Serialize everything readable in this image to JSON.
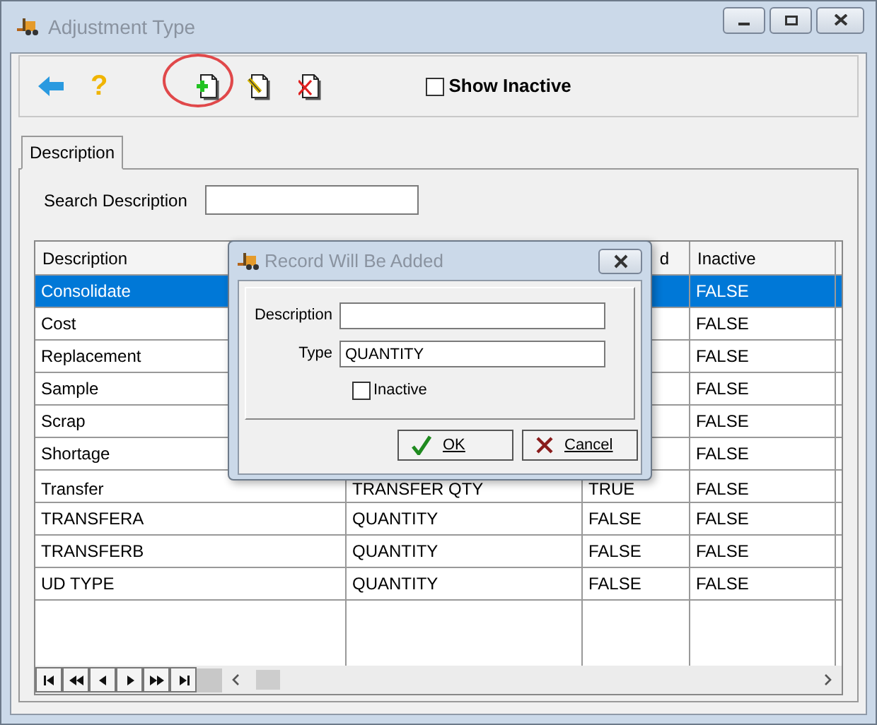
{
  "window": {
    "title": "Adjustment Type"
  },
  "toolbar": {
    "help": "?",
    "tools": [
      {
        "kind": "add",
        "highlighted": true
      },
      {
        "kind": "edit",
        "highlighted": false
      },
      {
        "kind": "delete",
        "highlighted": false
      }
    ],
    "show_inactive": {
      "label": "Show Inactive",
      "checked": false
    }
  },
  "tabs": [
    {
      "label": "Description",
      "selected": true
    }
  ],
  "search": {
    "label": "Search Description"
  },
  "table": {
    "columns": [
      {
        "label": "Description"
      },
      {},
      {
        "label": "d"
      },
      {
        "label": "Inactive"
      }
    ],
    "rows": [
      {
        "cells": [
          "Consolidate",
          null,
          null,
          "FALSE"
        ],
        "selected": true
      },
      {
        "cells": [
          "Cost",
          null,
          null,
          "FALSE"
        ],
        "selected": false
      },
      {
        "cells": [
          "Replacement",
          null,
          null,
          "FALSE"
        ],
        "selected": false
      },
      {
        "cells": [
          "Sample",
          null,
          null,
          "FALSE"
        ],
        "selected": false
      },
      {
        "cells": [
          "Scrap",
          null,
          null,
          "FALSE"
        ],
        "selected": false
      },
      {
        "cells": [
          "Shortage",
          null,
          null,
          "FALSE"
        ],
        "selected": false
      },
      {
        "cells": [
          "Transfer",
          "TRANSFER QTY",
          "TRUE",
          "FALSE"
        ],
        "selected": false
      },
      {
        "cells": [
          "TRANSFERA",
          "QUANTITY",
          "FALSE",
          "FALSE"
        ],
        "selected": false
      },
      {
        "cells": [
          "TRANSFERB",
          "QUANTITY",
          "FALSE",
          "FALSE"
        ],
        "selected": false
      },
      {
        "cells": [
          "UD TYPE",
          "QUANTITY",
          "FALSE",
          "FALSE"
        ],
        "selected": false
      }
    ]
  },
  "dialog": {
    "title": "Record Will Be Added",
    "fields": [
      {
        "label": "Description"
      },
      {
        "label": "Type",
        "value": "QUANTITY"
      }
    ],
    "inactive": {
      "label": "Inactive",
      "checked": false
    },
    "buttons": [
      {
        "kind": "ok",
        "label": "OK"
      },
      {
        "kind": "cancel",
        "label": "Cancel"
      }
    ]
  }
}
